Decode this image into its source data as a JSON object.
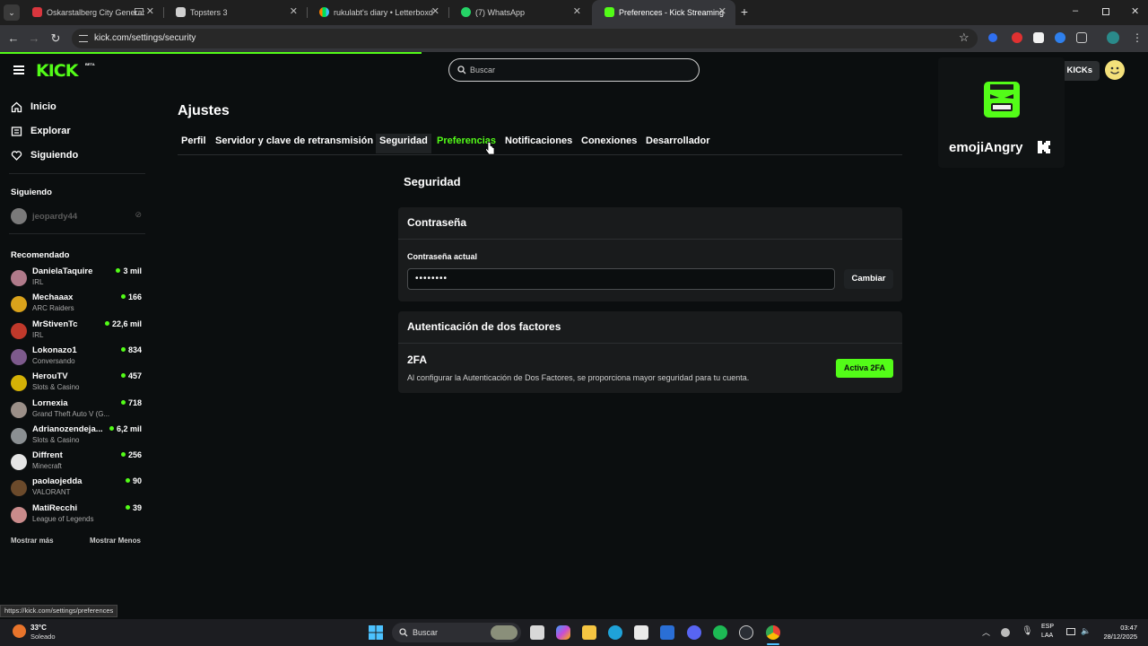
{
  "browser": {
    "tabs": [
      {
        "title": "Oskarstalberg City Generat",
        "icon": "tab-favicon-red"
      },
      {
        "title": "Topsters 3",
        "icon": "tab-favicon-doc"
      },
      {
        "title": "rukulabt's diary • Letterboxd",
        "icon": "letterboxd-icon"
      },
      {
        "title": "(7) WhatsApp",
        "icon": "whatsapp-icon"
      },
      {
        "title": "Preferences - Kick Streaming",
        "icon": "kick-icon"
      }
    ],
    "url": "kick.com/settings/security",
    "status_url": "https://kick.com/settings/preferences"
  },
  "header": {
    "logo": "KICK",
    "logo_badge": "BETA",
    "search_placeholder": "Buscar",
    "login_label": "n KICKs"
  },
  "emote_card": {
    "name": "emojiAngry"
  },
  "sidebar": {
    "nav": [
      {
        "label": "Inicio",
        "icon": "home-icon"
      },
      {
        "label": "Explorar",
        "icon": "browse-icon"
      },
      {
        "label": "Siguiendo",
        "icon": "heart-icon"
      }
    ],
    "following_header": "Siguiendo",
    "following": [
      {
        "name": "jeopardy44"
      }
    ],
    "recommended_header": "Recomendado",
    "recommended": [
      {
        "name": "DanielaTaquire",
        "category": "IRL",
        "viewers": "3 mil",
        "color": "#b07a8a"
      },
      {
        "name": "Mechaaax",
        "category": "ARC Raiders",
        "viewers": "166",
        "color": "#d9a21b"
      },
      {
        "name": "MrStivenTc",
        "category": "IRL",
        "viewers": "22,6 mil",
        "color": "#c0392b"
      },
      {
        "name": "Lokonazo1",
        "category": "Conversando",
        "viewers": "834",
        "color": "#7d5a8c"
      },
      {
        "name": "HerouTV",
        "category": "Slots & Casino",
        "viewers": "457",
        "color": "#d4b106"
      },
      {
        "name": "Lornexia",
        "category": "Grand Theft Auto V (G...",
        "viewers": "718",
        "color": "#9b8f88"
      },
      {
        "name": "Adrianozendeja...",
        "category": "Slots & Casino",
        "viewers": "6,2 mil",
        "color": "#8a8f92"
      },
      {
        "name": "Diffrent",
        "category": "Minecraft",
        "viewers": "256",
        "color": "#e5e5e5"
      },
      {
        "name": "paolaojedda",
        "category": "VALORANT",
        "viewers": "90",
        "color": "#6b4a2b"
      },
      {
        "name": "MatiRecchi",
        "category": "League of Legends",
        "viewers": "39",
        "color": "#c98b8b"
      }
    ],
    "show_more": "Mostrar más",
    "show_less": "Mostrar Menos"
  },
  "settings": {
    "title": "Ajustes",
    "tabs": [
      "Perfil",
      "Servidor y clave de retransmisión",
      "Seguridad",
      "Preferencias",
      "Notificaciones",
      "Conexiones",
      "Desarrollador"
    ],
    "section_title": "Seguridad",
    "password_card": {
      "title": "Contraseña",
      "field_label": "Contraseña actual",
      "field_value": "••••••••",
      "button": "Cambiar"
    },
    "twofa_card": {
      "title": "Autenticación de dos factores",
      "subtitle": "2FA",
      "description": "Al configurar la Autenticación de Dos Factores, se proporciona mayor seguridad para tu cuenta.",
      "button": "Activa 2FA"
    }
  },
  "taskbar": {
    "temperature": "33°C",
    "weather": "Soleado",
    "search": "Buscar",
    "lang": "ESP",
    "lang_region": "LAA",
    "time": "03:47",
    "date": "28/12/2025"
  },
  "colors": {
    "brand_green": "#53fc18",
    "background": "#0b0e0f",
    "card": "#191b1c"
  }
}
